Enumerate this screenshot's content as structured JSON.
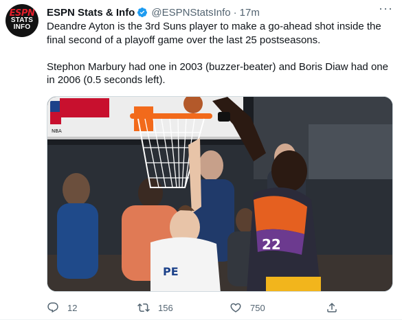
{
  "account": {
    "name": "ESPN Stats & Info",
    "handle": "@ESPNStatsInfo",
    "separator": "·",
    "time": "17m",
    "avatar": {
      "logo": "ESPN",
      "line1": "STATS",
      "line2": "INFO"
    }
  },
  "tweet": {
    "paragraph1": "Deandre Ayton is the 3rd Suns player to make a go-ahead shot inside the final second of a playoff game over the last 25 postseasons.",
    "paragraph2": "Stephon Marbury had one in 2003 (buzzer-beater) and Boris Diaw had one in 2006 (0.5 seconds left)."
  },
  "media": {
    "description_icon": "photo",
    "visible_text": {
      "backboard": "NBA",
      "jersey_left": "PE",
      "jersey_right": "22"
    }
  },
  "actions": {
    "reply_count": "12",
    "retweet_count": "156",
    "like_count": "750"
  },
  "colors": {
    "accent": "#1d9bf0",
    "muted": "#536471",
    "espn_red": "#e41e2b"
  }
}
